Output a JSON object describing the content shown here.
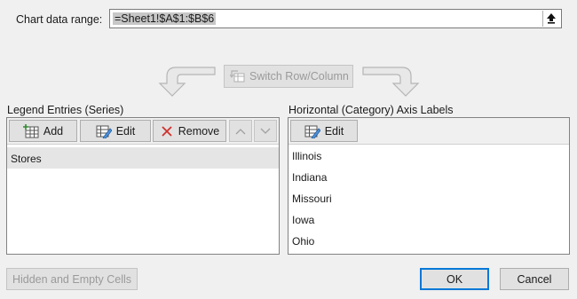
{
  "dialog": {
    "range_label": "Chart data range:",
    "range_value": "=Sheet1!$A$1:$B$6",
    "switch_label": "Switch Row/Column"
  },
  "legend": {
    "title": "Legend Entries (Series)",
    "add": "Add",
    "edit": "Edit",
    "remove": "Remove",
    "items": [
      "Stores"
    ]
  },
  "axis": {
    "title": "Horizontal (Category) Axis Labels",
    "edit": "Edit",
    "items": [
      "Illinois",
      "Indiana",
      "Missouri",
      "Iowa",
      "Ohio"
    ]
  },
  "footer": {
    "hidden_cells": "Hidden and Empty Cells",
    "ok": "OK",
    "cancel": "Cancel"
  }
}
